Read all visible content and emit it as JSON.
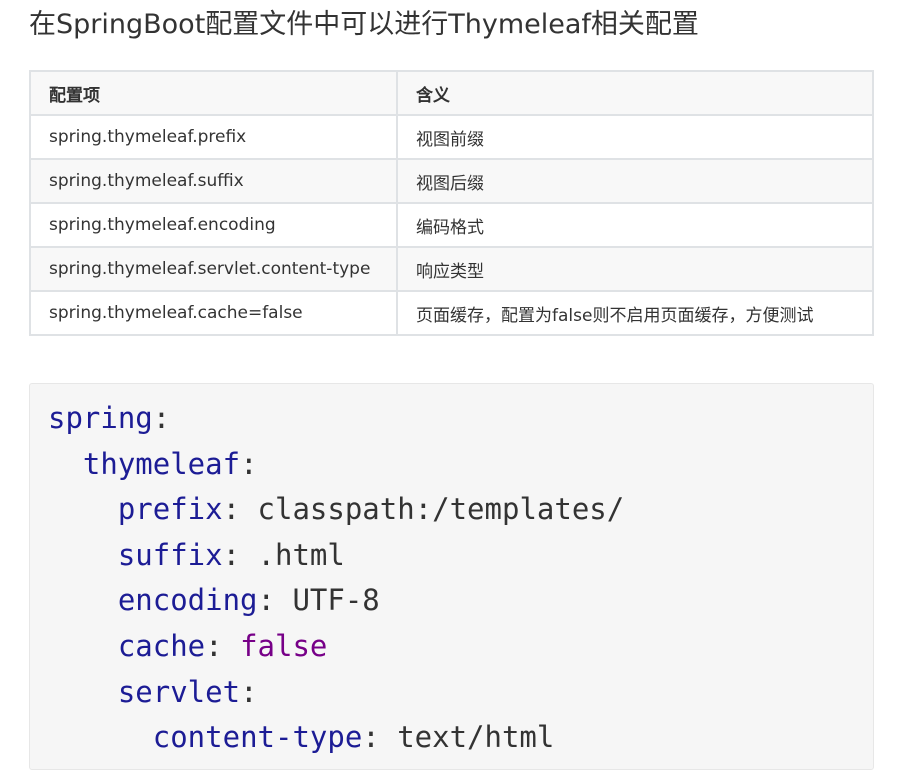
{
  "title": "在SpringBoot配置文件中可以进行Thymeleaf相关配置",
  "table": {
    "headers": [
      "配置项",
      "含义"
    ],
    "rows": [
      [
        "spring.thymeleaf.prefix",
        "视图前缀"
      ],
      [
        "spring.thymeleaf.suffix",
        "视图后缀"
      ],
      [
        "spring.thymeleaf.encoding",
        "编码格式"
      ],
      [
        "spring.thymeleaf.servlet.content-type",
        "响应类型"
      ],
      [
        "spring.thymeleaf.cache=false",
        "页面缓存，配置为false则不启用页面缓存，方便测试"
      ]
    ]
  },
  "code": {
    "lines": [
      {
        "indent": "",
        "key": "spring",
        "value": "",
        "type": "plain"
      },
      {
        "indent": "  ",
        "key": "thymeleaf",
        "value": "",
        "type": "plain"
      },
      {
        "indent": "    ",
        "key": "prefix",
        "value": "classpath:/templates/",
        "type": "plain"
      },
      {
        "indent": "    ",
        "key": "suffix",
        "value": ".html",
        "type": "plain"
      },
      {
        "indent": "    ",
        "key": "encoding",
        "value": "UTF-8",
        "type": "plain"
      },
      {
        "indent": "    ",
        "key": "cache",
        "value": "false",
        "type": "bool"
      },
      {
        "indent": "    ",
        "key": "servlet",
        "value": "",
        "type": "plain"
      },
      {
        "indent": "      ",
        "key": "content-type",
        "value": "text/html",
        "type": "plain"
      }
    ]
  },
  "colors": {
    "key": "#1c1c95",
    "bool": "#770088",
    "table_border": "#dfe2e5",
    "code_bg": "#f6f6f6"
  }
}
